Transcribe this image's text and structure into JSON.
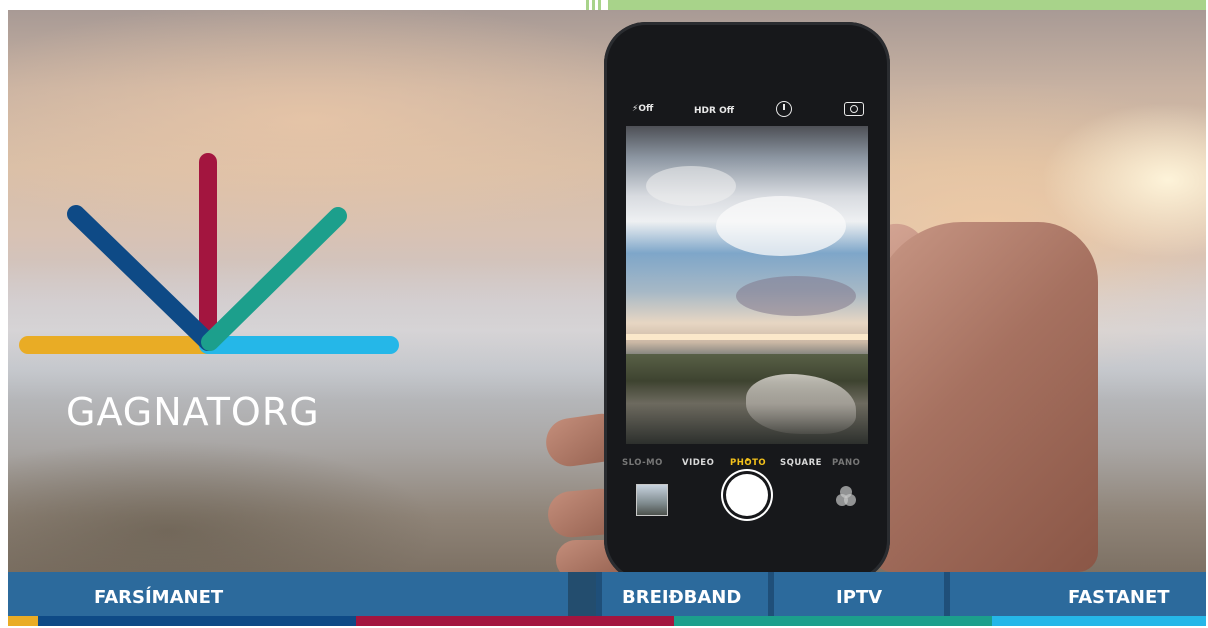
{
  "brand": {
    "name": "GAGNATORG",
    "colors": {
      "yellow": "#e9ac25",
      "blue": "#0e4a86",
      "red": "#a3153f",
      "teal": "#1c9f8c",
      "cyan": "#25b7e8"
    }
  },
  "phone": {
    "flash_label": "Off",
    "hdr_label": "HDR Off",
    "icons": [
      "flash-icon",
      "timer-icon",
      "camera-switch-icon",
      "filters-icon"
    ],
    "modes": [
      {
        "label": "SLO-MO",
        "state": "dim"
      },
      {
        "label": "VIDEO",
        "state": "normal"
      },
      {
        "label": "PHOTO",
        "state": "active"
      },
      {
        "label": "SQUARE",
        "state": "normal"
      },
      {
        "label": "PANO",
        "state": "dim"
      }
    ]
  },
  "nav": {
    "items": [
      {
        "label": "FARSÍMANET"
      },
      {
        "label": "BREIÐBAND"
      },
      {
        "label": "IPTV"
      },
      {
        "label": "FASTANET"
      }
    ],
    "color": "#2c6a9c"
  },
  "top_strip_color": "#a8d38a"
}
